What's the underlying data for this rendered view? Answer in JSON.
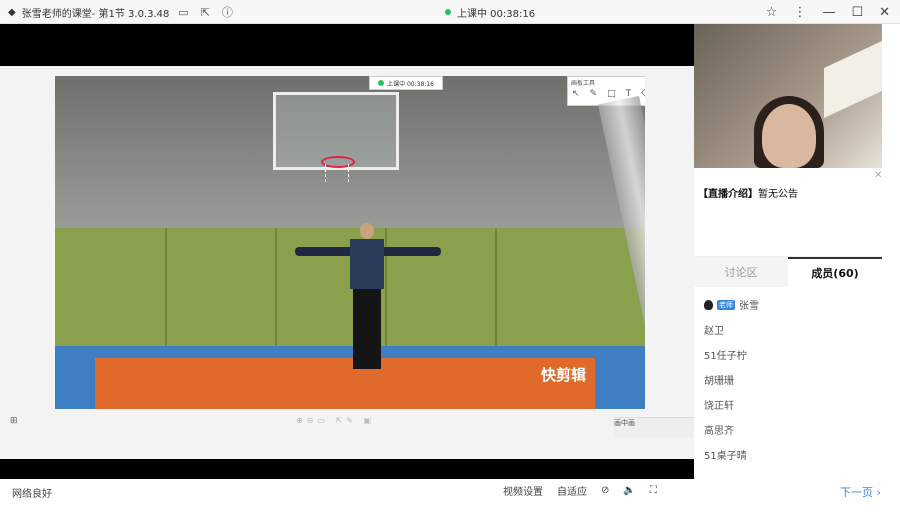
{
  "titlebar": {
    "app_title": "张雪老师的课堂- 第1节 3.0.3.48",
    "live_status": "上课中 00:38:16"
  },
  "screen": {
    "live_pill": "上课中 00:38:16",
    "tool_window_title": "画板工具",
    "tools": [
      "↖",
      "✎",
      "□",
      "T",
      "⌫"
    ],
    "watermark": "快剪辑",
    "mini_label": "画中画"
  },
  "bottombar": {
    "network": "网络良好",
    "video_settings": "视频设置",
    "adapt": "自适应",
    "next_page": "下一页"
  },
  "sidebar": {
    "announcement_title": "【直播介绍】",
    "announcement_text": "暂无公告",
    "tabs": [
      "讨论区",
      "成员(60)"
    ],
    "teacher_badge": "老师",
    "teacher_name": "张雪",
    "members": [
      "赵卫",
      "51任子柠",
      "胡珊珊",
      "饶正轩",
      "高思齐",
      "51桌子晴"
    ]
  }
}
